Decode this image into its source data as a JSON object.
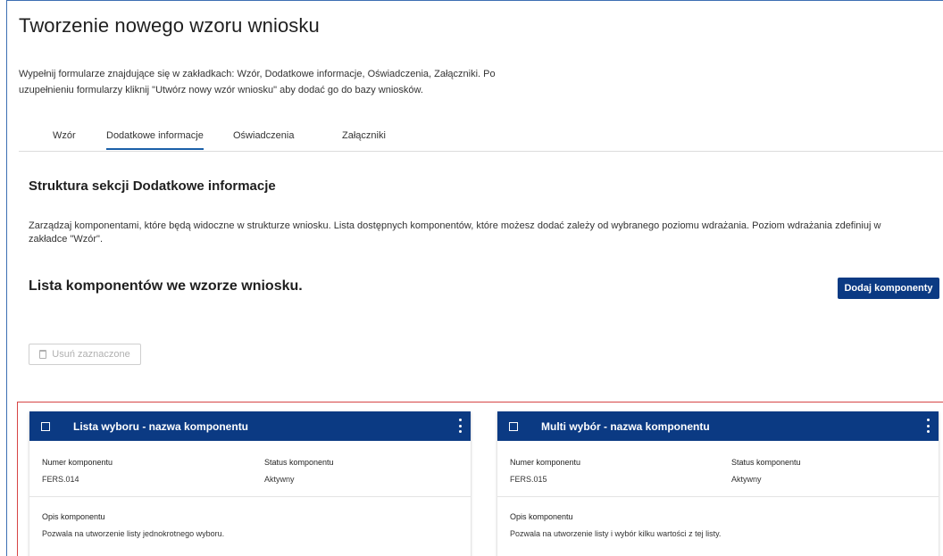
{
  "page": {
    "title": "Tworzenie nowego wzoru wniosku",
    "intro_line1": "Wypełnij formularze znajdujące się w zakładkach: Wzór, Dodatkowe informacje, Oświadczenia, Załączniki. Po",
    "intro_line2": "uzupełnieniu formularzy kliknij \"Utwórz nowy wzór wniosku\" aby dodać go do bazy wniosków."
  },
  "tabs": [
    {
      "label": "Wzór",
      "active": false
    },
    {
      "label": "Dodatkowe informacje",
      "active": true
    },
    {
      "label": "Oświadczenia",
      "active": false
    },
    {
      "label": "Załączniki",
      "active": false
    }
  ],
  "section": {
    "title": "Struktura sekcji Dodatkowe informacje",
    "desc_line1": "Zarządzaj komponentami, które będą widoczne w strukturze wniosku. Lista dostępnych komponentów, które możesz dodać zależy od wybranego poziomu wdrażania. Poziom wdrażania zdefiniuj w",
    "desc_line2": "zakładce \"Wzór\"."
  },
  "list": {
    "title": "Lista komponentów we wzorze wniosku.",
    "add_button": "Dodaj komponenty",
    "delete_button": "Usuń zaznaczone",
    "delete_icon": "trash-icon"
  },
  "cards": [
    {
      "title": "Lista wyboru - nazwa komponentu",
      "number_label": "Numer komponentu",
      "number_value": "FERS.014",
      "status_label": "Status komponentu",
      "status_value": "Aktywny",
      "desc_label": "Opis komponentu",
      "desc_value": "Pozwala na utworzenie listy jednokrotnego wyboru."
    },
    {
      "title": "Multi wybór - nazwa komponentu",
      "number_label": "Numer komponentu",
      "number_value": "FERS.015",
      "status_label": "Status komponentu",
      "status_value": "Aktywny",
      "desc_label": "Opis komponentu",
      "desc_value": "Pozwala na utworzenie listy i wybór kilku wartości z tej listy."
    }
  ],
  "colors": {
    "accent": "#0b3a83",
    "tab_underline": "#1a5fa8",
    "highlight_border": "#d64545"
  }
}
